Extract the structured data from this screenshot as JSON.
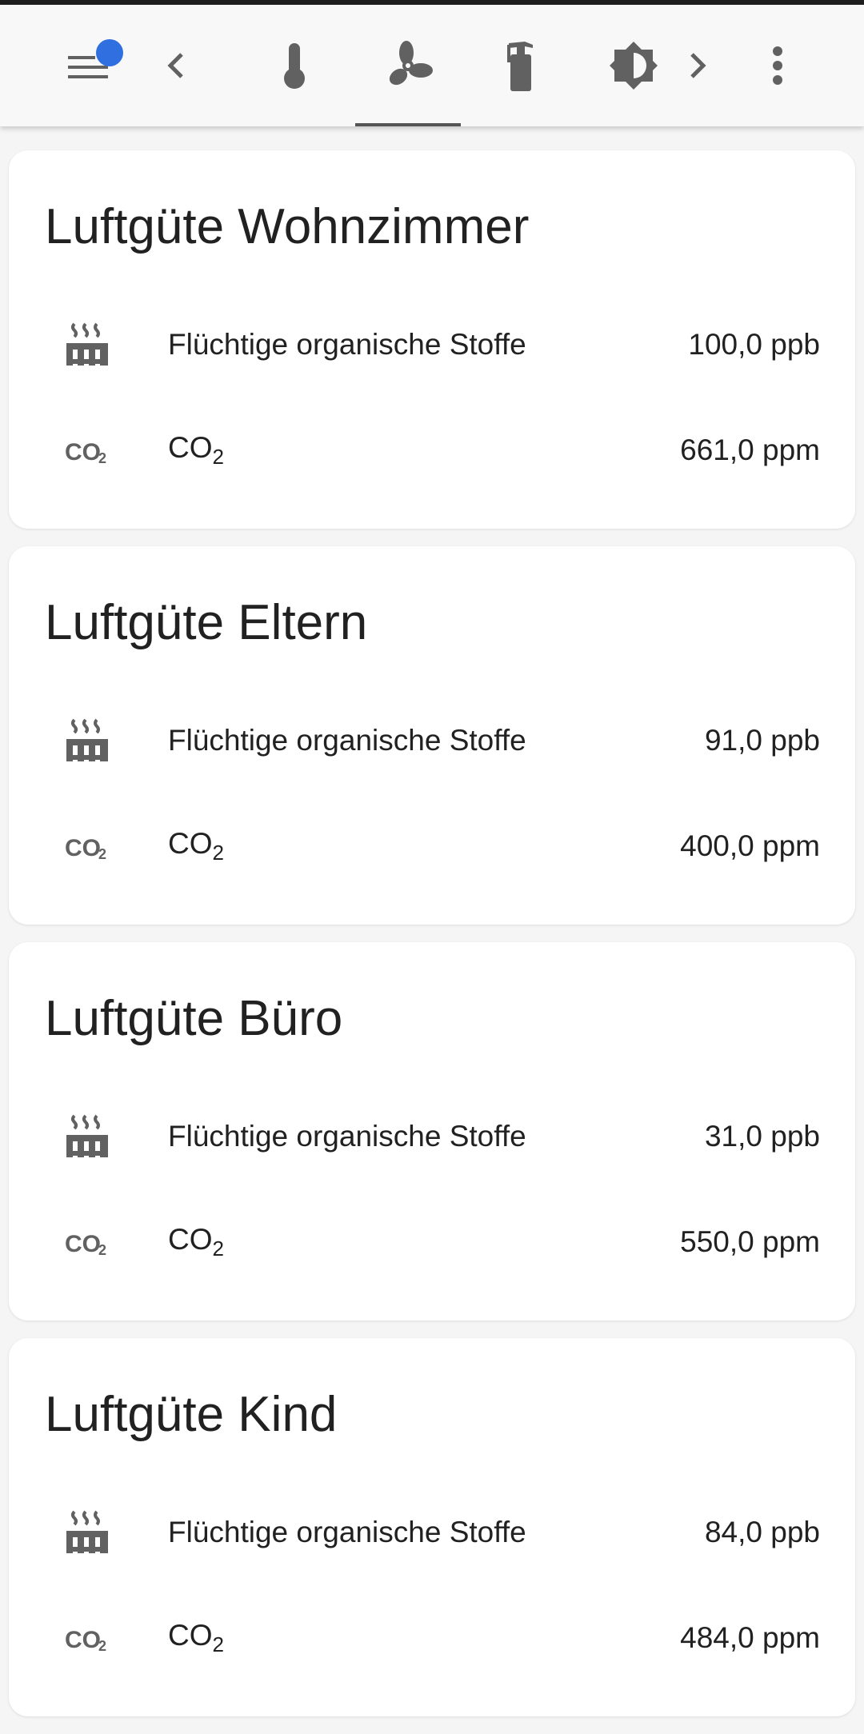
{
  "toolbar": {
    "icons": [
      "menu-icon",
      "chevron-left-icon",
      "thermometer-icon",
      "fan-icon",
      "fire-extinguisher-icon",
      "brightness-icon",
      "chevron-right-icon",
      "more-vert-icon"
    ],
    "badge_color": "#2f6fe0",
    "selected_tab": "fan"
  },
  "cards": [
    {
      "title": "Luftgüte Wohnzimmer",
      "voc_label": "Flüchtige organische Stoffe",
      "voc_value": "100,0 ppb",
      "co2_label": "CO",
      "co2_sub": "2",
      "co2_value": "661,0 ppm"
    },
    {
      "title": "Luftgüte Eltern",
      "voc_label": "Flüchtige organische Stoffe",
      "voc_value": "91,0 ppb",
      "co2_label": "CO",
      "co2_sub": "2",
      "co2_value": "400,0 ppm"
    },
    {
      "title": "Luftgüte Büro",
      "voc_label": "Flüchtige organische Stoffe",
      "voc_value": "31,0 ppb",
      "co2_label": "CO",
      "co2_sub": "2",
      "co2_value": "550,0 ppm"
    },
    {
      "title": "Luftgüte Kind",
      "voc_label": "Flüchtige organische Stoffe",
      "voc_value": "84,0 ppb",
      "co2_label": "CO",
      "co2_sub": "2",
      "co2_value": "484,0 ppm"
    }
  ],
  "colors": {
    "icon": "#616161",
    "tab_indicator": "#555555",
    "background": "#f5f5f5"
  }
}
